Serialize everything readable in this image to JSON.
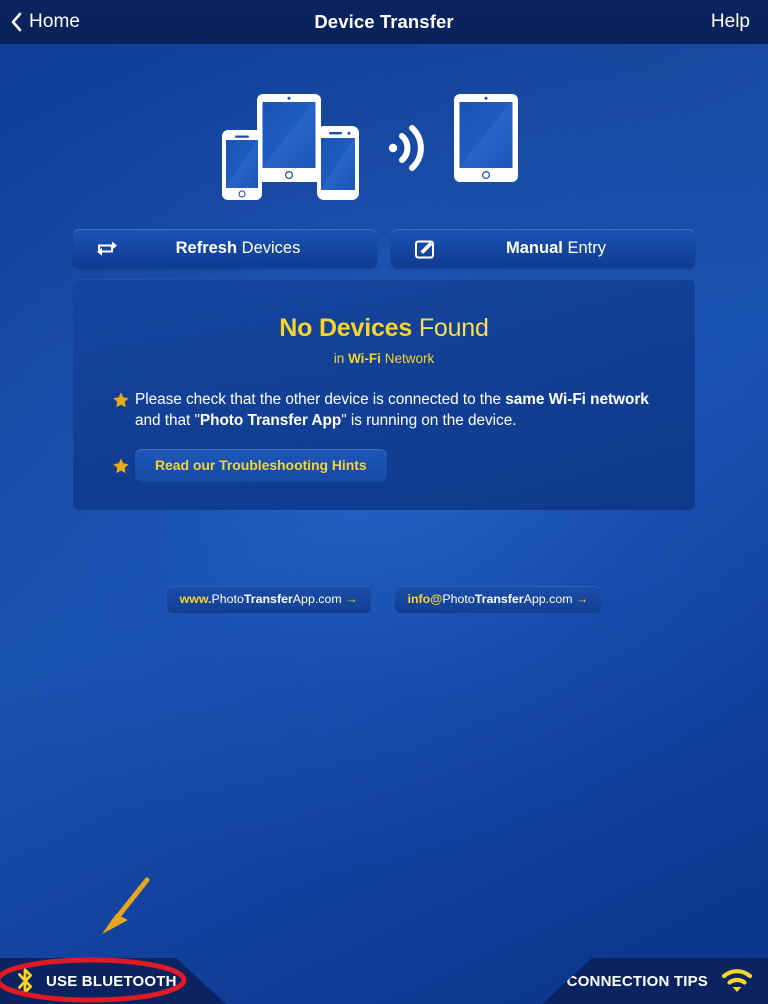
{
  "navbar": {
    "back_label": "Home",
    "title": "Device Transfer",
    "help_label": "Help"
  },
  "illustration": {
    "left_devices": [
      "iphone-icon",
      "ipad-icon",
      "android-phone-icon"
    ],
    "signal": "wifi-broadcast-icon",
    "right_devices": [
      "ipad-icon"
    ]
  },
  "actions": [
    {
      "icon": "refresh-icon",
      "bold": "Refresh",
      "rest": " Devices"
    },
    {
      "icon": "compose-icon",
      "bold": "Manual",
      "rest": " Entry"
    }
  ],
  "panel": {
    "title_bold": "No Devices",
    "title_rest": " Found",
    "sub_pre": "in ",
    "sub_bold": "Wi-Fi",
    "sub_post": " Network",
    "bullet1_a": "Please check that the other device is connected to the ",
    "bullet1_b": "same Wi-Fi network",
    "bullet1_c": " and that \"",
    "bullet1_d": "Photo Transfer App",
    "bullet1_e": "\" is running on the device.",
    "hint_button": "Read our Troubleshooting Hints"
  },
  "links": [
    {
      "p1": "www.",
      "p2": "Photo",
      "p3": "Transfer",
      "p4": "App.com",
      "arrow": " →"
    },
    {
      "p1": "info@",
      "p2": "Photo",
      "p3": "Transfer",
      "p4": "App.com",
      "arrow": " →"
    }
  ],
  "bottombar": {
    "bluetooth_label": "USE BLUETOOTH",
    "bluetooth_icon": "bluetooth-icon",
    "tips_label": "CONNECTION TIPS",
    "tips_icon": "wifi-icon"
  },
  "annotations": {
    "arrow_color": "#e8a61e",
    "ellipse_color": "#e01b24"
  },
  "colors": {
    "accent_yellow": "#f6d42c",
    "panel_blue": "#12407a",
    "nav_navy": "#0b2461",
    "page_blue": "#1448ab"
  }
}
